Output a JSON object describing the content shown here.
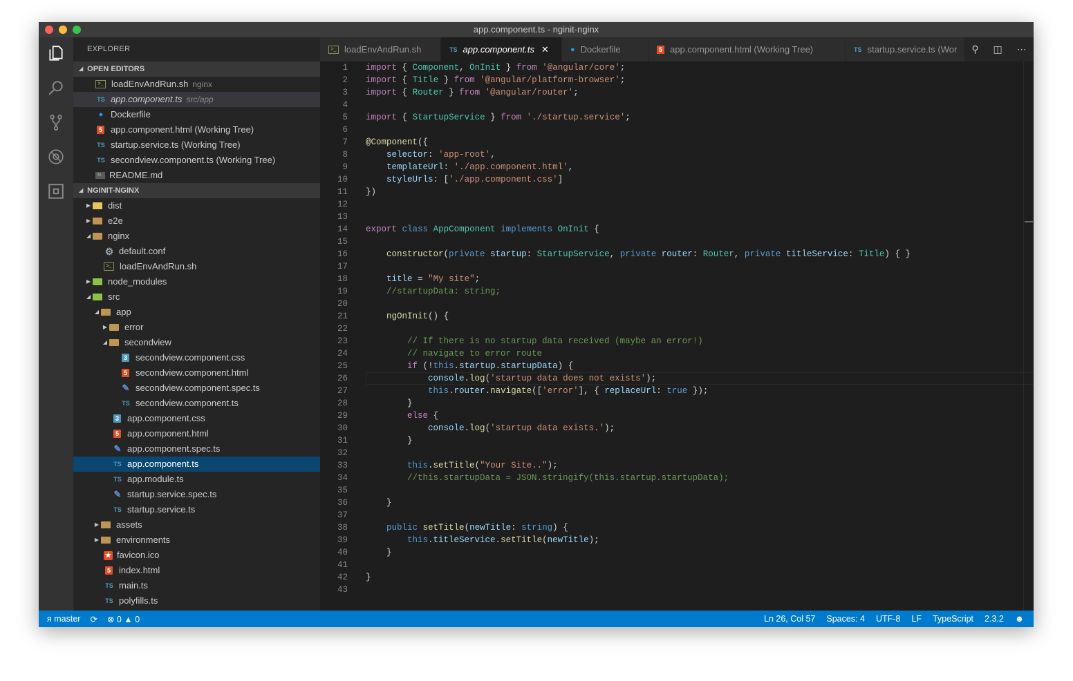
{
  "window": {
    "title": "app.component.ts - nginit-nginx"
  },
  "activity_bar": [
    "explorer-icon",
    "search-icon",
    "source-control-icon",
    "debug-icon",
    "extensions-icon"
  ],
  "sidebar": {
    "title": "EXPLORER",
    "open_editors": {
      "header": "OPEN EDITORS",
      "items": [
        {
          "name": "loadEnvAndRun.sh",
          "desc": "nginx"
        },
        {
          "name": "app.component.ts",
          "desc": "src/app"
        },
        {
          "name": "Dockerfile",
          "desc": ""
        },
        {
          "name": "app.component.html (Working Tree)",
          "desc": ""
        },
        {
          "name": "startup.service.ts (Working Tree)",
          "desc": ""
        },
        {
          "name": "secondview.component.ts (Working Tree)",
          "desc": ""
        },
        {
          "name": "README.md",
          "desc": ""
        }
      ]
    },
    "project": {
      "header": "NGINIT-NGINX",
      "items": [
        {
          "name": "dist"
        },
        {
          "name": "e2e"
        },
        {
          "name": "nginx"
        },
        {
          "name": "default.conf"
        },
        {
          "name": "loadEnvAndRun.sh"
        },
        {
          "name": "node_modules"
        },
        {
          "name": "src"
        },
        {
          "name": "app"
        },
        {
          "name": "error"
        },
        {
          "name": "secondview"
        },
        {
          "name": "secondview.component.css"
        },
        {
          "name": "secondview.component.html"
        },
        {
          "name": "secondview.component.spec.ts"
        },
        {
          "name": "secondview.component.ts"
        },
        {
          "name": "app.component.css"
        },
        {
          "name": "app.component.html"
        },
        {
          "name": "app.component.spec.ts"
        },
        {
          "name": "app.component.ts"
        },
        {
          "name": "app.module.ts"
        },
        {
          "name": "startup.service.spec.ts"
        },
        {
          "name": "startup.service.ts"
        },
        {
          "name": "assets"
        },
        {
          "name": "environments"
        },
        {
          "name": "favicon.ico"
        },
        {
          "name": "index.html"
        },
        {
          "name": "main.ts"
        },
        {
          "name": "polyfills.ts"
        }
      ]
    }
  },
  "tabs": [
    {
      "label": "loadEnvAndRun.sh"
    },
    {
      "label": "app.component.ts"
    },
    {
      "label": "Dockerfile"
    },
    {
      "label": "app.component.html (Working Tree)"
    },
    {
      "label": "startup.service.ts (Wor"
    }
  ],
  "code_lines": [
    "import { Component, OnInit } from '@angular/core';",
    "import { Title } from '@angular/platform-browser';",
    "import { Router } from '@angular/router';",
    "",
    "import { StartupService } from './startup.service';",
    "",
    "@Component({",
    "    selector: 'app-root',",
    "    templateUrl: './app.component.html',",
    "    styleUrls: ['./app.component.css']",
    "})",
    "",
    "",
    "export class AppComponent implements OnInit {",
    "",
    "    constructor(private startup: StartupService, private router: Router, private titleService: Title) { }",
    "",
    "    title = \"My site\";",
    "    //startupData: string;",
    "",
    "    ngOnInit() {",
    "",
    "        // If there is no startup data received (maybe an error!)",
    "        // navigate to error route",
    "        if (!this.startup.startupData) {",
    "            console.log('startup data does not exists');",
    "            this.router.navigate(['error'], { replaceUrl: true });",
    "        }",
    "        else {",
    "            console.log('startup data exists.');",
    "        }",
    "",
    "        this.setTitle(\"Your Site..\");",
    "        //this.startupData = JSON.stringify(this.startup.startupData);",
    "",
    "    }",
    "",
    "    public setTitle(newTitle: string) {",
    "        this.titleService.setTitle(newTitle);",
    "    }",
    "",
    "}",
    ""
  ],
  "status": {
    "branch": "master",
    "errors": "0",
    "warnings": "0",
    "position": "Ln 26, Col 57",
    "spaces": "Spaces: 4",
    "encoding": "UTF-8",
    "eol": "LF",
    "language": "TypeScript",
    "version": "2.3.2"
  }
}
